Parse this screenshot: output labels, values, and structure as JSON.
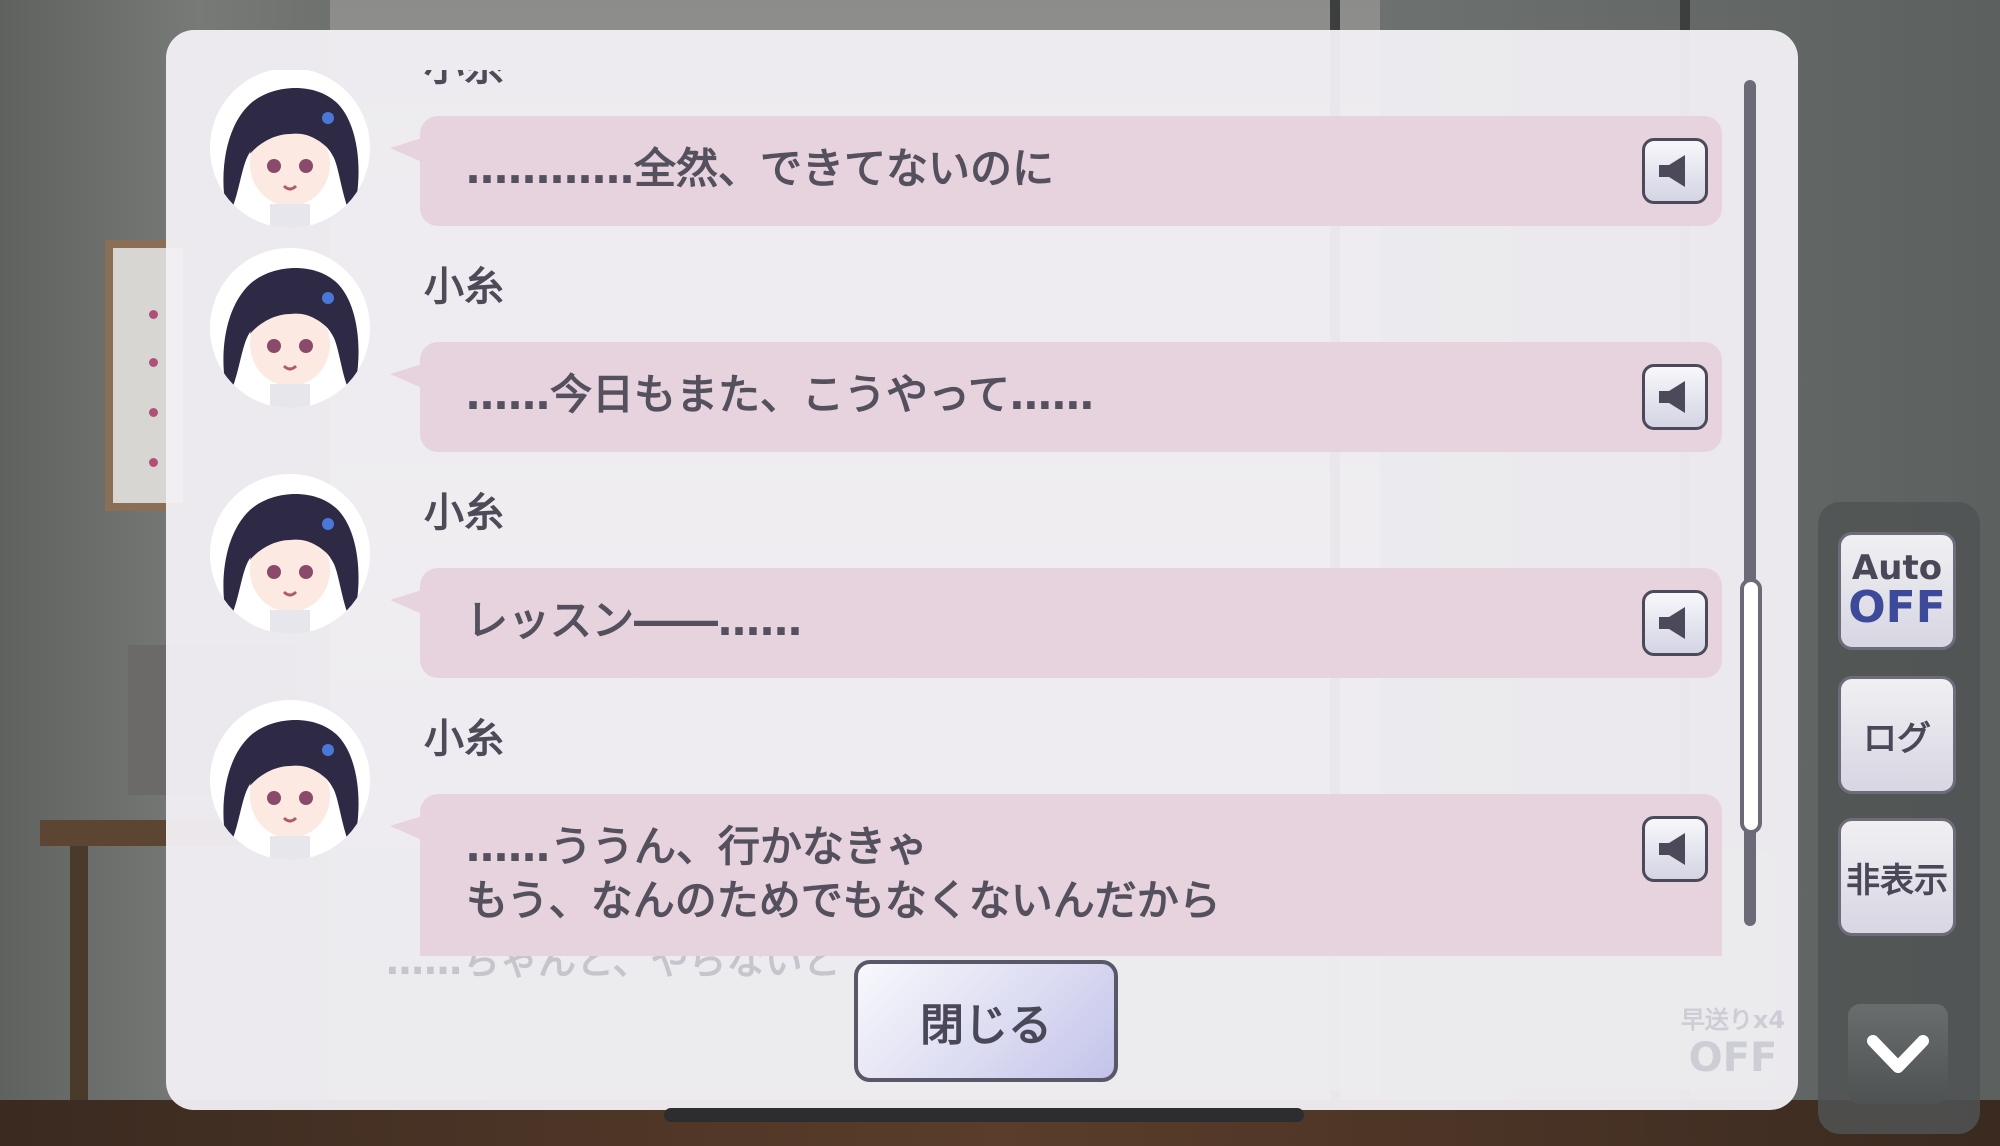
{
  "log": {
    "entries": [
      {
        "speaker": "小糸",
        "text": "…………全然、できてないのに"
      },
      {
        "speaker": "小糸",
        "text": "……今日もまた、こうやって……"
      },
      {
        "speaker": "小糸",
        "text": "レッスン――……"
      },
      {
        "speaker": "小糸",
        "text": "……ううん、行かなきゃ\nもう、なんのためでもなくないんだから"
      }
    ],
    "close_label": "閉じる"
  },
  "background_dialogue": {
    "text": "……ちゃんと、やらないと",
    "skip_label": "早送りx4",
    "skip_state": "OFF"
  },
  "controls": {
    "auto_label": "Auto",
    "auto_state": "OFF",
    "log_label": "ログ",
    "hide_label": "非表示"
  },
  "icons": {
    "voice": "speaker-icon",
    "avatar": "koito-avatar-icon",
    "menu": "chevron-down-icon"
  },
  "colors": {
    "bubble": "#e7d3dd",
    "accent_blue": "#3d4a9a",
    "text": "#55505e"
  }
}
